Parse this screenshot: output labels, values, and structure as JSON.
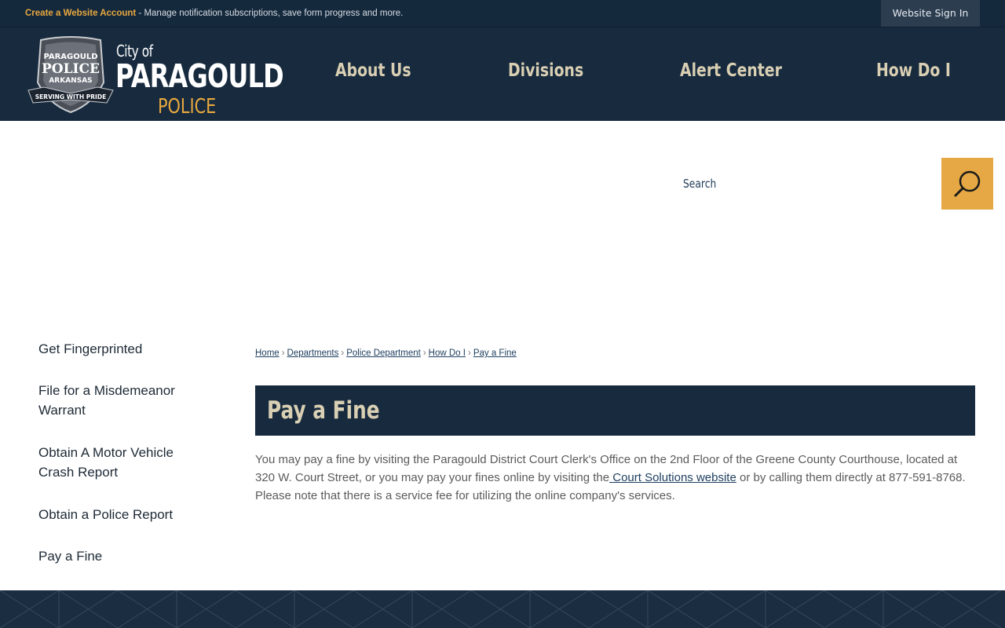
{
  "topbar": {
    "create_account": "Create a Website Account",
    "message": " - Manage notification subscriptions, save form progress and more.",
    "sign_in": "Website Sign In"
  },
  "logo": {
    "badge_line1": "PARAGOULD",
    "badge_line2": "POLICE",
    "badge_line3": "ARKANSAS",
    "badge_ribbon": "SERVING WITH PRIDE",
    "city_of": "City of",
    "name": "PARAGOULD",
    "police": "POLICE"
  },
  "nav": {
    "items": [
      {
        "label": "About Us"
      },
      {
        "label": "Divisions"
      },
      {
        "label": "Alert Center"
      },
      {
        "label": "How Do I"
      }
    ]
  },
  "search": {
    "label": "Search"
  },
  "sidebar": {
    "items": [
      {
        "label": "Get Fingerprinted"
      },
      {
        "label": "File for a Misdemeanor Warrant"
      },
      {
        "label": "Obtain A Motor Vehicle Crash Report"
      },
      {
        "label": "Obtain a Police Report"
      },
      {
        "label": "Pay a Fine"
      }
    ]
  },
  "breadcrumb": {
    "items": [
      {
        "label": "Home"
      },
      {
        "label": "Departments"
      },
      {
        "label": "Police Department"
      },
      {
        "label": "How Do I"
      },
      {
        "label": "Pay a Fine"
      }
    ],
    "separator": "›"
  },
  "page": {
    "title": "Pay a Fine",
    "body_part1": "You may pay a fine by visiting the Paragould District Court Clerk's Office on the 2nd Floor of the Greene County Courthouse, located at 320 W. Court Street, or you may pay your fines online by visiting the",
    "body_link": " Court Solutions website",
    "body_part2": " or by calling them directly at 877-591-8768.  Please note that there is a service fee for utilizing the online company's services."
  },
  "colors": {
    "navy": "#172a3e",
    "gold": "#e5a844",
    "nav_text": "#d9cfb3"
  }
}
